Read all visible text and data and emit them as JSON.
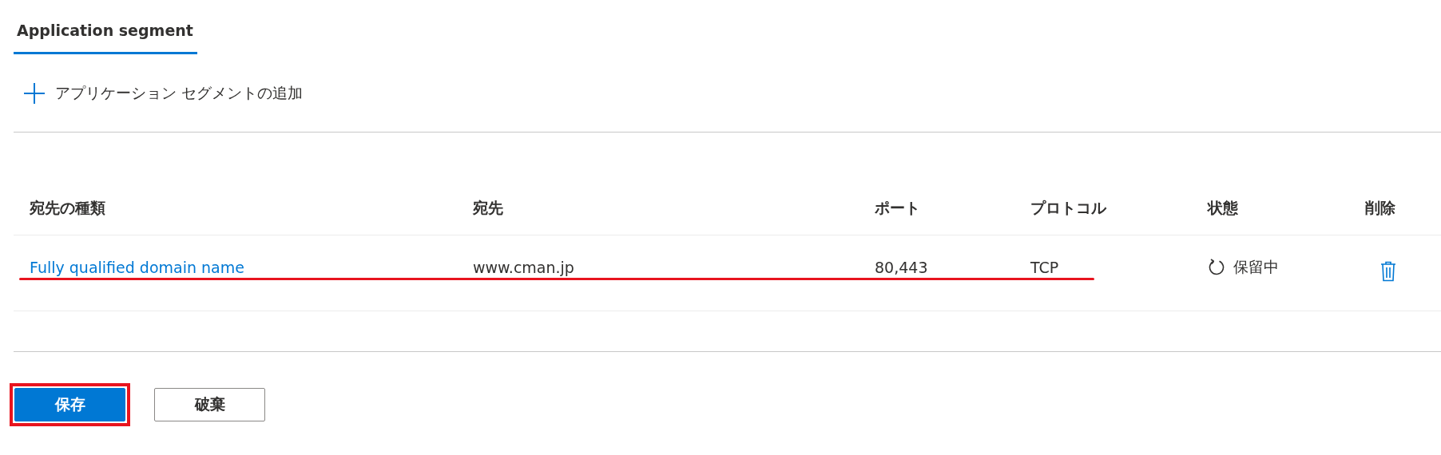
{
  "tabs": [
    {
      "label": "Application segment",
      "selected": true
    }
  ],
  "add_button": {
    "label": "アプリケーション セグメントの追加"
  },
  "table": {
    "columns": [
      "宛先の種類",
      "宛先",
      "ポート",
      "プロトコル",
      "状態",
      "削除"
    ],
    "rows": [
      {
        "destination_type": "Fully qualified domain name",
        "destination": "www.cman.jp",
        "port": "80,443",
        "protocol": "TCP",
        "status": {
          "kind": "pending",
          "label": "保留中"
        }
      }
    ]
  },
  "buttons": [
    {
      "label": "保存",
      "kind": "primary"
    },
    {
      "label": "破棄",
      "kind": "secondary"
    }
  ]
}
